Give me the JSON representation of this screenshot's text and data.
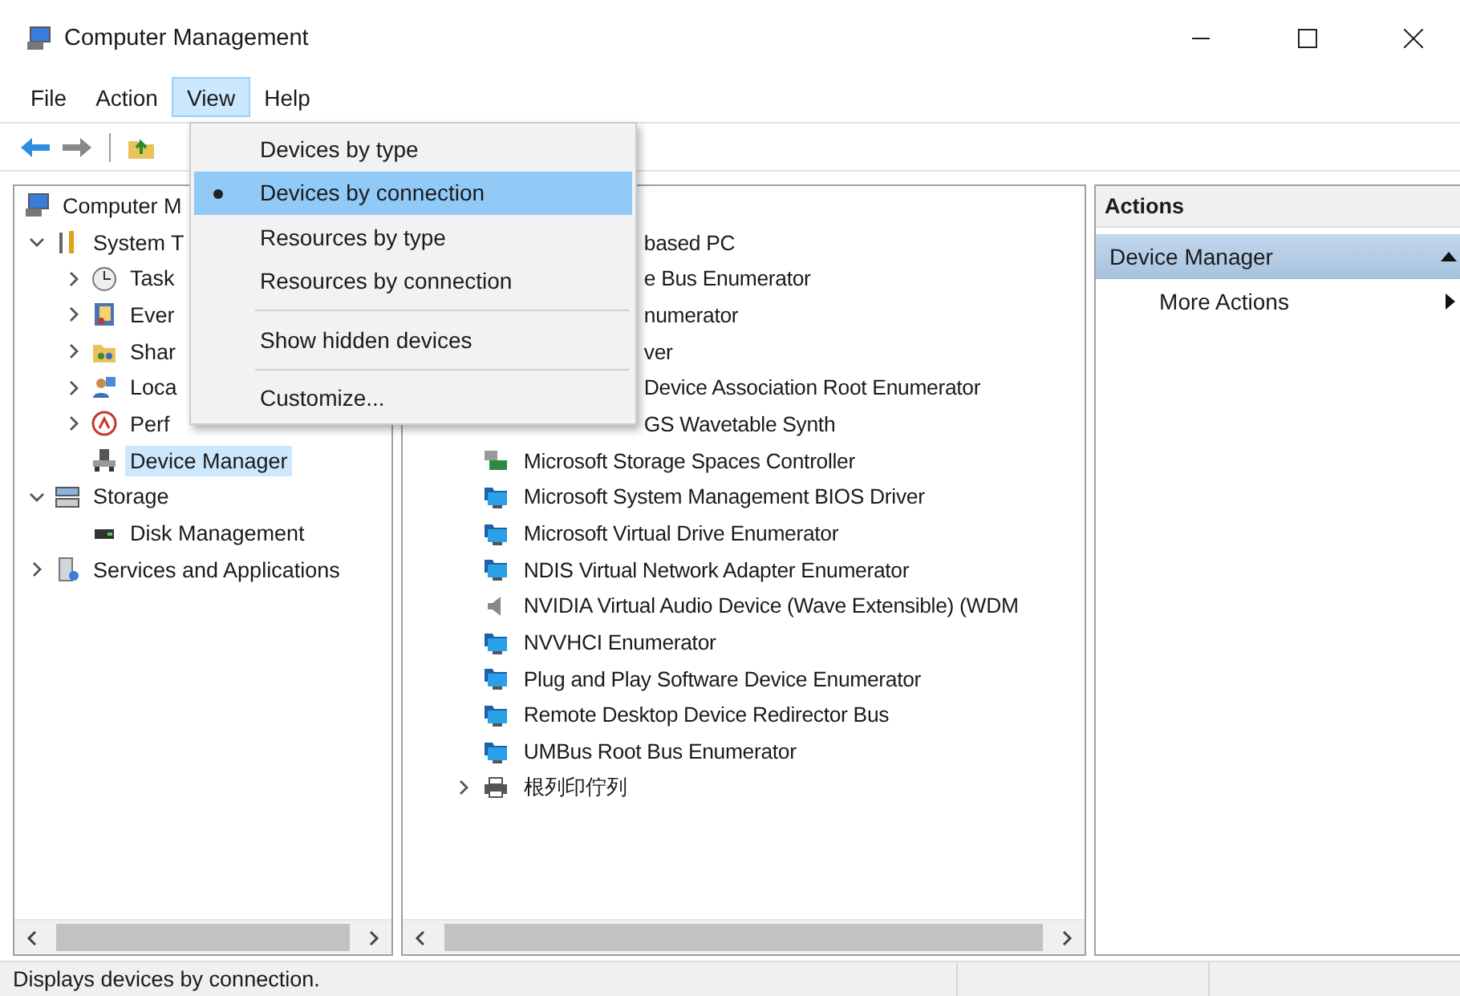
{
  "window": {
    "title": "Computer Management"
  },
  "menu_bar": [
    {
      "label": "File",
      "selected": false
    },
    {
      "label": "Action",
      "selected": false
    },
    {
      "label": "View",
      "selected": true
    },
    {
      "label": "Help",
      "selected": false
    }
  ],
  "view_menu": [
    {
      "kind": "item",
      "label": "Devices by type",
      "selected": false
    },
    {
      "kind": "item",
      "label": "Devices by connection",
      "selected": true
    },
    {
      "kind": "item",
      "label": "Resources by type",
      "selected": false
    },
    {
      "kind": "item",
      "label": "Resources by connection",
      "selected": false
    },
    {
      "kind": "separator"
    },
    {
      "kind": "item",
      "label": "Show hidden devices",
      "selected": false
    },
    {
      "kind": "separator"
    },
    {
      "kind": "item",
      "label": "Customize...",
      "selected": false
    }
  ],
  "tree": [
    {
      "label": "Computer M",
      "selected": false,
      "children": [
        {
          "label": "System T",
          "expanded": true,
          "selected": false,
          "children": [
            {
              "label": "Task",
              "expanded": false,
              "selected": false
            },
            {
              "label": "Ever",
              "expanded": false,
              "selected": false
            },
            {
              "label": "Shar",
              "expanded": false,
              "selected": false
            },
            {
              "label": "Loca",
              "expanded": false,
              "selected": false
            },
            {
              "label": "Perf",
              "expanded": false,
              "selected": false
            },
            {
              "label": "Device Manager",
              "selected": true
            }
          ]
        },
        {
          "label": "Storage",
          "expanded": true,
          "selected": false,
          "children": [
            {
              "label": "Disk Management",
              "selected": false
            }
          ]
        },
        {
          "label": "Services and Applications",
          "expanded": false,
          "selected": false
        }
      ]
    }
  ],
  "devices": [
    {
      "kind": "covered",
      "label": "based PC",
      "selected": false
    },
    {
      "kind": "covered",
      "label": "e Bus Enumerator",
      "selected": false
    },
    {
      "kind": "covered",
      "label": "numerator",
      "selected": false
    },
    {
      "kind": "covered",
      "label": "ver",
      "selected": false
    },
    {
      "kind": "covered",
      "label": "Device Association Root Enumerator",
      "selected": false
    },
    {
      "kind": "covered",
      "label": "GS Wavetable Synth",
      "selected": false
    },
    {
      "kind": "storage",
      "label": "Microsoft Storage Spaces Controller",
      "selected": false
    },
    {
      "kind": "device",
      "label": "Microsoft System Management BIOS Driver",
      "selected": false
    },
    {
      "kind": "device",
      "label": "Microsoft Virtual Drive Enumerator",
      "selected": false
    },
    {
      "kind": "device",
      "label": "NDIS Virtual Network Adapter Enumerator",
      "selected": false
    },
    {
      "kind": "audio",
      "label": "NVIDIA Virtual Audio Device (Wave Extensible) (WDM",
      "selected": false
    },
    {
      "kind": "device",
      "label": "NVVHCI Enumerator",
      "selected": false
    },
    {
      "kind": "device",
      "label": "Plug and Play Software Device Enumerator",
      "selected": false
    },
    {
      "kind": "device",
      "label": "Remote Desktop Device Redirector Bus",
      "selected": false
    },
    {
      "kind": "device",
      "label": "UMBus Root Bus Enumerator",
      "selected": false
    },
    {
      "kind": "printer",
      "label": "根列印佇列",
      "expanded": false,
      "selected": false
    }
  ],
  "actions": {
    "title": "Actions",
    "section": {
      "label": "Device Manager",
      "expanded": true
    },
    "items": [
      {
        "label": "More Actions"
      }
    ]
  },
  "status_bar": {
    "text": "Displays devices by connection."
  }
}
